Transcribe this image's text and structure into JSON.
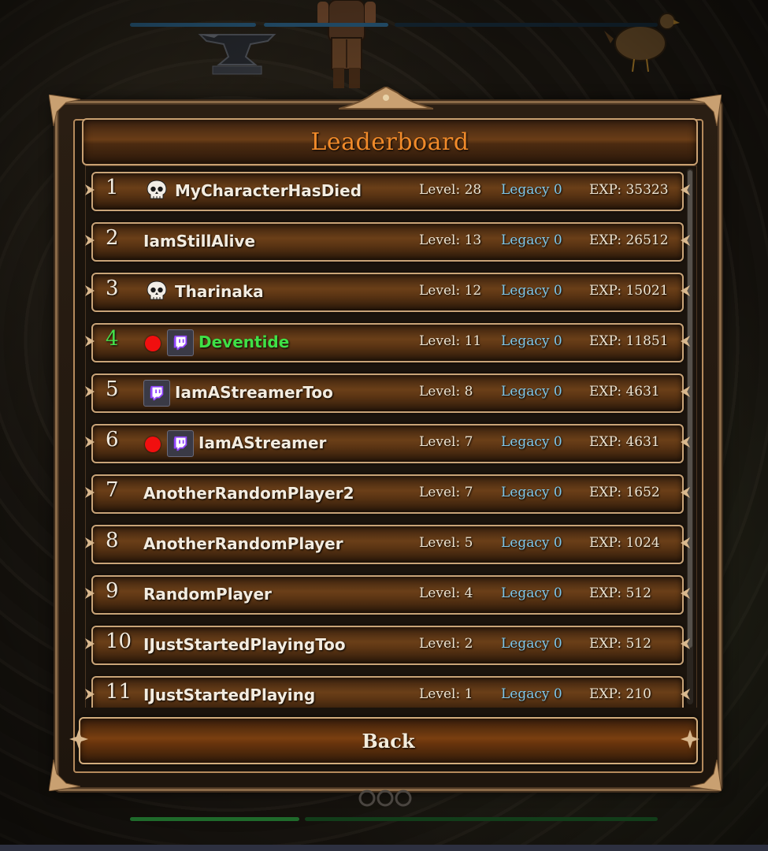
{
  "title": "Leaderboard",
  "back_label": "Back",
  "colors": {
    "title": "#f08a2a",
    "legacy": "#7fc7ea",
    "live_name": "#3fe046",
    "live_dot": "#f10f0f"
  },
  "entries": [
    {
      "rank": "1",
      "name": "MyCharacterHasDied",
      "level": "Level: 28",
      "legacy": "Legacy 0",
      "exp": "EXP: 35323",
      "dead": true,
      "live": false,
      "twitch": false
    },
    {
      "rank": "2",
      "name": "IamStillAlive",
      "level": "Level: 13",
      "legacy": "Legacy 0",
      "exp": "EXP: 26512",
      "dead": false,
      "live": false,
      "twitch": false
    },
    {
      "rank": "3",
      "name": "Tharinaka",
      "level": "Level: 12",
      "legacy": "Legacy 0",
      "exp": "EXP: 15021",
      "dead": true,
      "live": false,
      "twitch": false
    },
    {
      "rank": "4",
      "name": "Deventide",
      "level": "Level: 11",
      "legacy": "Legacy 0",
      "exp": "EXP: 11851",
      "dead": false,
      "live": true,
      "twitch": true
    },
    {
      "rank": "5",
      "name": "IamAStreamerToo",
      "level": "Level: 8",
      "legacy": "Legacy 0",
      "exp": "EXP: 4631",
      "dead": false,
      "live": false,
      "twitch": true
    },
    {
      "rank": "6",
      "name": "IamAStreamer",
      "level": "Level: 7",
      "legacy": "Legacy 0",
      "exp": "EXP: 4631",
      "dead": false,
      "live": false,
      "twitch": true,
      "recording": true
    },
    {
      "rank": "7",
      "name": "AnotherRandomPlayer2",
      "level": "Level: 7",
      "legacy": "Legacy 0",
      "exp": "EXP: 1652",
      "dead": false,
      "live": false,
      "twitch": false
    },
    {
      "rank": "8",
      "name": "AnotherRandomPlayer",
      "level": "Level: 5",
      "legacy": "Legacy 0",
      "exp": "EXP: 1024",
      "dead": false,
      "live": false,
      "twitch": false
    },
    {
      "rank": "9",
      "name": "RandomPlayer",
      "level": "Level: 4",
      "legacy": "Legacy 0",
      "exp": "EXP: 512",
      "dead": false,
      "live": false,
      "twitch": false
    },
    {
      "rank": "10",
      "name": "IJustStartedPlayingToo",
      "level": "Level: 2",
      "legacy": "Legacy 0",
      "exp": "EXP: 512",
      "dead": false,
      "live": false,
      "twitch": false
    },
    {
      "rank": "11",
      "name": "IJustStartedPlaying",
      "level": "Level: 1",
      "legacy": "Legacy 0",
      "exp": "EXP: 210",
      "dead": false,
      "live": false,
      "twitch": false
    }
  ]
}
